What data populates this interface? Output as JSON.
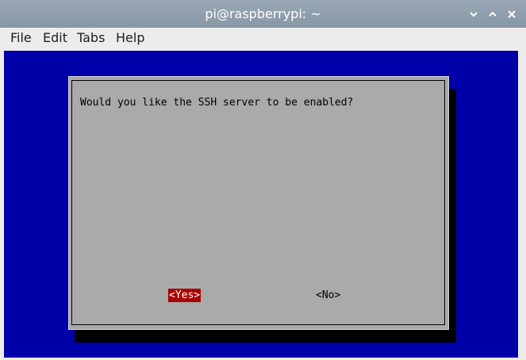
{
  "window": {
    "title": "pi@raspberrypi: ~"
  },
  "titlebar_buttons": [
    {
      "name": "minimize",
      "icon": "chevron-down-icon"
    },
    {
      "name": "maximize",
      "icon": "chevron-up-icon"
    },
    {
      "name": "close",
      "icon": "close-icon"
    }
  ],
  "menubar": {
    "items": [
      "File",
      "Edit",
      "Tabs",
      "Help"
    ]
  },
  "terminal": {
    "background": "#0000a8",
    "dialog": {
      "message": "Would you like the SSH server to be enabled?",
      "yes_label": "<Yes>",
      "no_label": "<No>",
      "selected": "Yes",
      "dialog_color": "#aaaaaa",
      "selected_color": "#aa0000"
    }
  }
}
